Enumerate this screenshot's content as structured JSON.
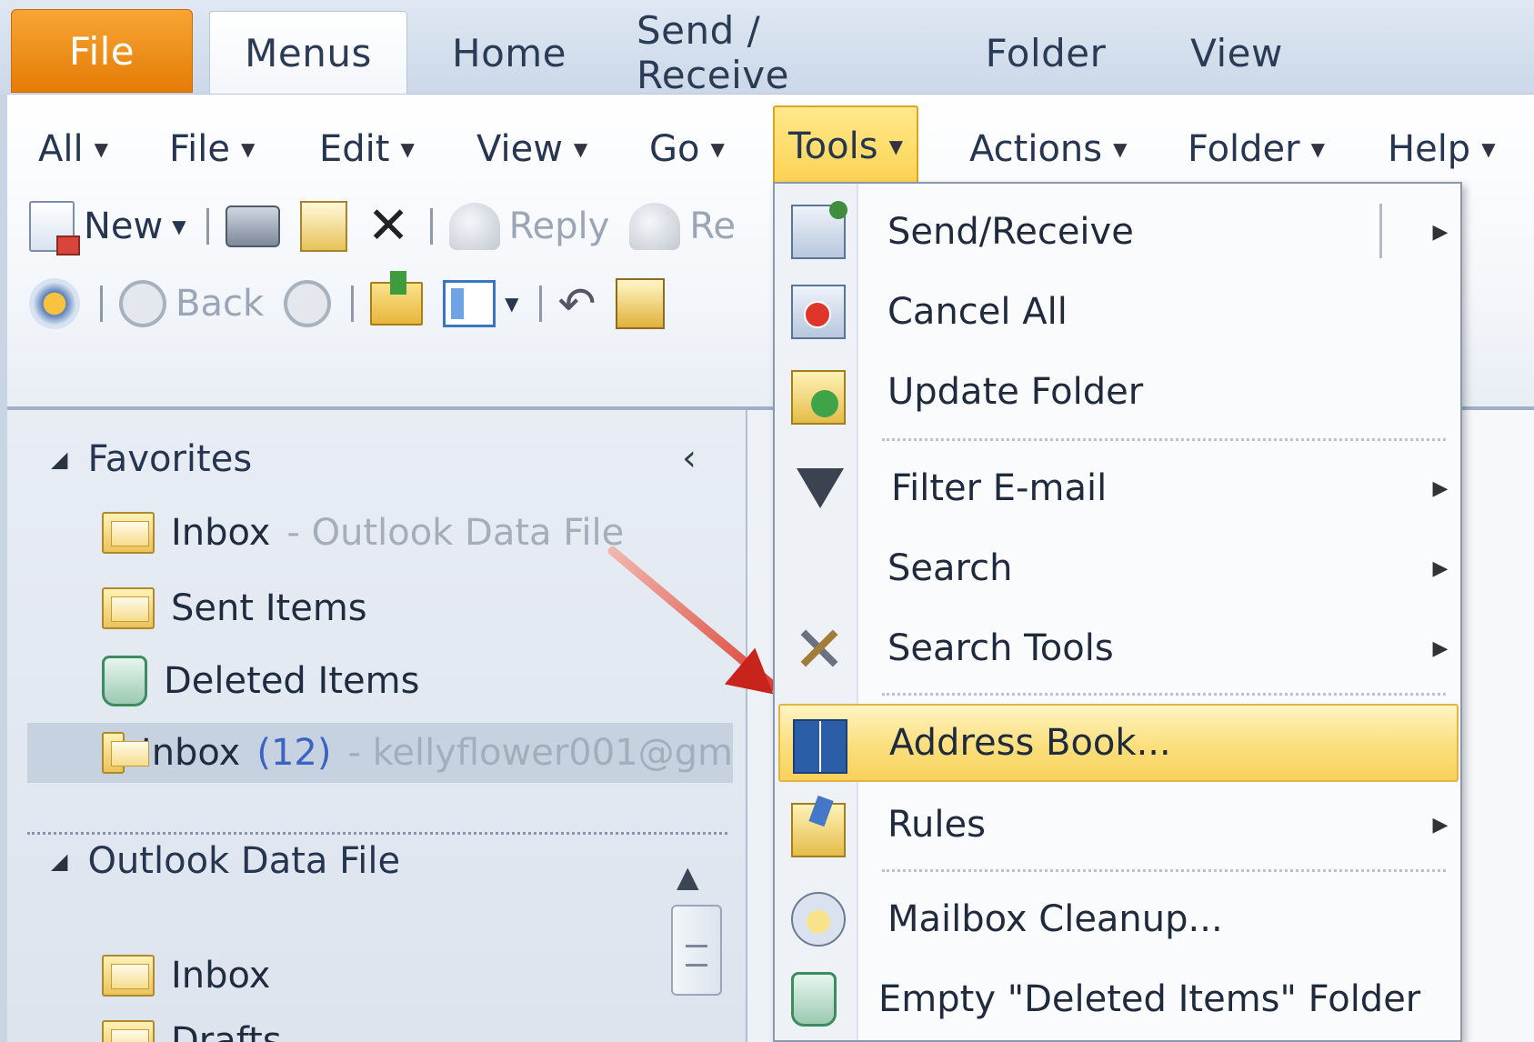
{
  "tabs": {
    "file": "File",
    "menus": "Menus",
    "home": "Home",
    "send_receive": "Send / Receive",
    "folder": "Folder",
    "view": "View"
  },
  "menubar": {
    "all": "All",
    "file": "File",
    "edit": "Edit",
    "view": "View",
    "go": "Go",
    "tools": "Tools",
    "actions": "Actions",
    "folder": "Folder",
    "help": "Help"
  },
  "toolbar": {
    "new": "New",
    "reply": "Reply",
    "reply_partial": "Re",
    "back": "Back"
  },
  "navpane": {
    "favorites": "Favorites",
    "outlook_data_file": "Outlook Data File",
    "items": {
      "inbox_fav": "Inbox",
      "inbox_fav_sub": " - Outlook Data File",
      "sent_items": "Sent Items",
      "deleted_items": "Deleted Items",
      "inbox_selected": "Inbox",
      "inbox_selected_count": " (12)",
      "inbox_selected_sub": " - kellyflower001@gm",
      "inbox2": "Inbox",
      "drafts": "Drafts"
    }
  },
  "tools_menu": {
    "items": [
      {
        "label": "Send/Receive",
        "icon": "send-receive-icon",
        "submenu": true
      },
      {
        "label": "Cancel All",
        "icon": "cancel-all-icon",
        "submenu": false
      },
      {
        "label": "Update Folder",
        "icon": "update-folder-icon",
        "submenu": false
      },
      {
        "label": "Filter E-mail",
        "icon": "filter-icon",
        "submenu": true
      },
      {
        "label": "Search",
        "icon": "",
        "submenu": true
      },
      {
        "label": "Search Tools",
        "icon": "search-tools-icon",
        "submenu": true
      },
      {
        "label": "Address Book...",
        "icon": "address-book-icon",
        "submenu": false,
        "highlighted": true
      },
      {
        "label": "Rules",
        "icon": "rules-icon",
        "submenu": true
      },
      {
        "label": "Mailbox Cleanup...",
        "icon": "mailbox-cleanup-icon",
        "submenu": false
      },
      {
        "label": "Empty \"Deleted Items\" Folder",
        "icon": "empty-trash-icon",
        "submenu": false
      }
    ]
  },
  "colors": {
    "file_tab": "#e57c06",
    "highlight": "#fbdf7d",
    "unread_count": "#3b63c4",
    "arrow": "#c8241b"
  }
}
